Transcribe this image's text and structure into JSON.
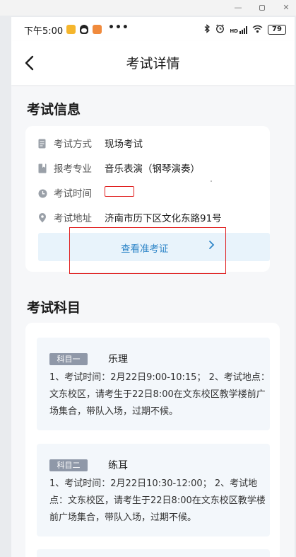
{
  "status_bar": {
    "time": "下午5:00",
    "more": "•••",
    "network": "HD",
    "battery": "79"
  },
  "nav": {
    "title": "考试详情"
  },
  "exam_info": {
    "section_title": "考试信息",
    "rows": [
      {
        "label": "考试方式",
        "value": "现场考试",
        "icon": "document-icon"
      },
      {
        "label": "报考专业",
        "value": "音乐表演（钢琴演奏）",
        "icon": "bookmark-icon"
      },
      {
        "label": "考试时间",
        "value": "",
        "icon": "clock-icon"
      },
      {
        "label": "考试地址",
        "value": "济南市历下区文化东路91号",
        "icon": "location-pin-icon"
      }
    ],
    "ticket_button": "查看准考证"
  },
  "subjects": {
    "section_title": "考试科目",
    "items": [
      {
        "badge": "科目一",
        "name": "乐理",
        "description": "1、考试时间：2月22日9:00-10:15；  2、考试地点：文东校区，请考生于22日8:00在文东校区教学楼前广场集合，带队入场，过期不候。"
      },
      {
        "badge": "科目二",
        "name": "练耳",
        "description": "1、考试时间：2月22日10:30-12:00；  2、考试地点：文东校区，请考生于22日8:00在文东校区教学楼前广场集合，带队入场，过期不候。"
      }
    ]
  },
  "colors": {
    "accent": "#2f86c8",
    "highlight_border": "#e02020",
    "badge_bg": "#8f98a8",
    "page_bg": "#f6f7f9"
  }
}
